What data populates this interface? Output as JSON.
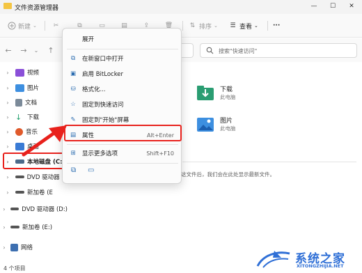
{
  "window": {
    "title": "文件资源管理器"
  },
  "toolbar": {
    "new_label": "新建",
    "sort_label": "排序",
    "view_label": "查看",
    "more_label": "···"
  },
  "search": {
    "placeholder": "搜索\"快速访问\""
  },
  "sidebar": {
    "items": [
      {
        "label": "视频",
        "icon": "video-folder-icon",
        "color": "#8a4fd8"
      },
      {
        "label": "图片",
        "icon": "pictures-folder-icon",
        "color": "#3d8fe0"
      },
      {
        "label": "文档",
        "icon": "documents-folder-icon",
        "color": "#7b8a99"
      },
      {
        "label": "下载",
        "icon": "downloads-folder-icon",
        "color": "#1f9e6b"
      },
      {
        "label": "音乐",
        "icon": "music-folder-icon",
        "color": "#e05a2b"
      },
      {
        "label": "桌面",
        "icon": "desktop-folder-icon",
        "color": "#3a7bd5"
      },
      {
        "label": "本地磁盘 (C:)",
        "icon": "drive-icon",
        "color": "#4a6a8a"
      },
      {
        "label": "DVD 驱动器 (E",
        "icon": "dvd-drive-icon",
        "color": "#555555"
      },
      {
        "label": "新加卷 (E",
        "icon": "drive-icon",
        "color": "#555555"
      },
      {
        "label": "DVD 驱动器 (D:)",
        "icon": "dvd-drive-icon",
        "color": "#555555"
      },
      {
        "label": "新加卷 (E:)",
        "icon": "drive-icon",
        "color": "#555555"
      },
      {
        "label": "网络",
        "icon": "network-icon",
        "color": "#3d6fb0"
      }
    ]
  },
  "content": {
    "items": [
      {
        "title": "下载",
        "subtitle": "此电脑"
      },
      {
        "title": "图片",
        "subtitle": "此电脑"
      }
    ],
    "empty_text": "这文件后，我们会在此处显示最新文件。"
  },
  "menu": {
    "items": [
      {
        "label": "展开",
        "shortcut": "",
        "icon": ""
      },
      {
        "label": "在新窗口中打开",
        "shortcut": "",
        "icon": "open-new-window-icon"
      },
      {
        "label": "启用 BitLocker",
        "shortcut": "",
        "icon": "bitlocker-icon"
      },
      {
        "label": "格式化...",
        "shortcut": "",
        "icon": "format-icon"
      },
      {
        "label": "固定到快速访问",
        "shortcut": "",
        "icon": "pin-icon"
      },
      {
        "label": "固定到\"开始\"屏幕",
        "shortcut": "",
        "icon": "pin-start-icon"
      },
      {
        "label": "属性",
        "shortcut": "Alt+Enter",
        "icon": "properties-icon"
      },
      {
        "label": "显示更多选项",
        "shortcut": "Shift+F10",
        "icon": "more-options-icon"
      }
    ]
  },
  "status": {
    "text": "4 个项目"
  },
  "watermark": {
    "text": "系统之家",
    "sub": "XITONGZHIJIA.NET"
  },
  "colors": {
    "accent": "#e8211c",
    "brand": "#2f6fd6"
  }
}
